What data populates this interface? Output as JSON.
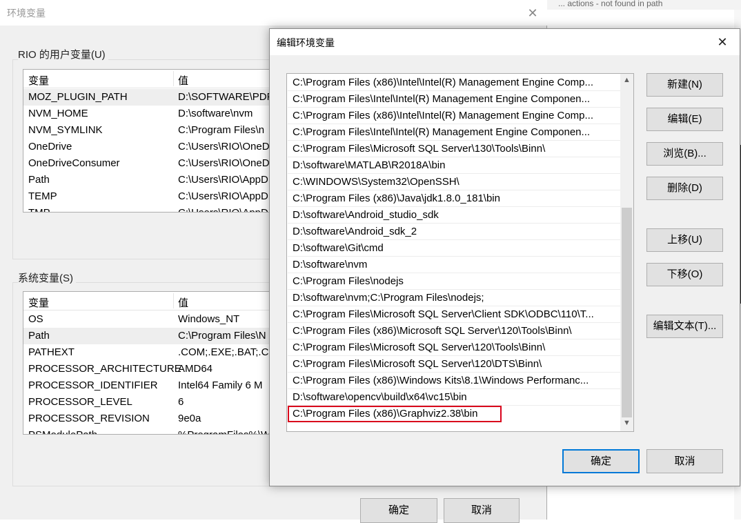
{
  "background": {
    "topbar_text": "... actions - not found in path"
  },
  "outer_window": {
    "title": "环境变量",
    "close_glyph": "✕",
    "user_vars": {
      "group_label": "RIO 的用户变量(U)",
      "col_var": "变量",
      "col_val": "值",
      "rows": [
        {
          "name": "MOZ_PLUGIN_PATH",
          "value": "D:\\SOFTWARE\\PDF"
        },
        {
          "name": "NVM_HOME",
          "value": "D:\\software\\nvm"
        },
        {
          "name": "NVM_SYMLINK",
          "value": "C:\\Program Files\\n"
        },
        {
          "name": "OneDrive",
          "value": "C:\\Users\\RIO\\OneD"
        },
        {
          "name": "OneDriveConsumer",
          "value": "C:\\Users\\RIO\\OneD"
        },
        {
          "name": "Path",
          "value": "C:\\Users\\RIO\\AppD"
        },
        {
          "name": "TEMP",
          "value": "C:\\Users\\RIO\\AppD"
        },
        {
          "name": "TMP",
          "value": "C:\\Users\\RIO\\AppD"
        }
      ]
    },
    "sys_vars": {
      "group_label": "系统变量(S)",
      "col_var": "变量",
      "col_val": "值",
      "rows": [
        {
          "name": "OS",
          "value": "Windows_NT"
        },
        {
          "name": "Path",
          "value": "C:\\Program Files\\N"
        },
        {
          "name": "PATHEXT",
          "value": ".COM;.EXE;.BAT;.CI"
        },
        {
          "name": "PROCESSOR_ARCHITECTURE",
          "value": "AMD64"
        },
        {
          "name": "PROCESSOR_IDENTIFIER",
          "value": "Intel64 Family 6 M"
        },
        {
          "name": "PROCESSOR_LEVEL",
          "value": "6"
        },
        {
          "name": "PROCESSOR_REVISION",
          "value": "9e0a"
        },
        {
          "name": "PSModulePath",
          "value": "%ProgramFiles%\\W"
        }
      ]
    },
    "ok_label": "确定",
    "cancel_label": "取消"
  },
  "edit_dialog": {
    "title": "编辑环境变量",
    "close_glyph": "✕",
    "entries": [
      "C:\\Program Files (x86)\\Intel\\Intel(R) Management Engine Comp...",
      "C:\\Program Files\\Intel\\Intel(R) Management Engine Componen...",
      "C:\\Program Files (x86)\\Intel\\Intel(R) Management Engine Comp...",
      "C:\\Program Files\\Intel\\Intel(R) Management Engine Componen...",
      "C:\\Program Files\\Microsoft SQL Server\\130\\Tools\\Binn\\",
      "D:\\software\\MATLAB\\R2018A\\bin",
      "C:\\WINDOWS\\System32\\OpenSSH\\",
      "C:\\Program Files (x86)\\Java\\jdk1.8.0_181\\bin",
      "D:\\software\\Android_studio_sdk",
      "D:\\software\\Android_sdk_2",
      "D:\\software\\Git\\cmd",
      "D:\\software\\nvm",
      "C:\\Program Files\\nodejs",
      "D:\\software\\nvm;C:\\Program Files\\nodejs;",
      "C:\\Program Files\\Microsoft SQL Server\\Client SDK\\ODBC\\110\\T...",
      "C:\\Program Files (x86)\\Microsoft SQL Server\\120\\Tools\\Binn\\",
      "C:\\Program Files\\Microsoft SQL Server\\120\\Tools\\Binn\\",
      "C:\\Program Files\\Microsoft SQL Server\\120\\DTS\\Binn\\",
      "C:\\Program Files (x86)\\Windows Kits\\8.1\\Windows Performanc...",
      "D:\\software\\opencv\\build\\x64\\vc15\\bin",
      "C:\\Program Files (x86)\\Graphviz2.38\\bin"
    ],
    "highlight_color": "#d9001b",
    "scroll_up_glyph": "▲",
    "scroll_down_glyph": "▼",
    "buttons": {
      "new": "新建(N)",
      "edit": "编辑(E)",
      "browse": "浏览(B)...",
      "delete": "删除(D)",
      "move_up": "上移(U)",
      "move_down": "下移(O)",
      "edit_text": "编辑文本(T)..."
    },
    "ok_label": "确定",
    "cancel_label": "取消"
  }
}
